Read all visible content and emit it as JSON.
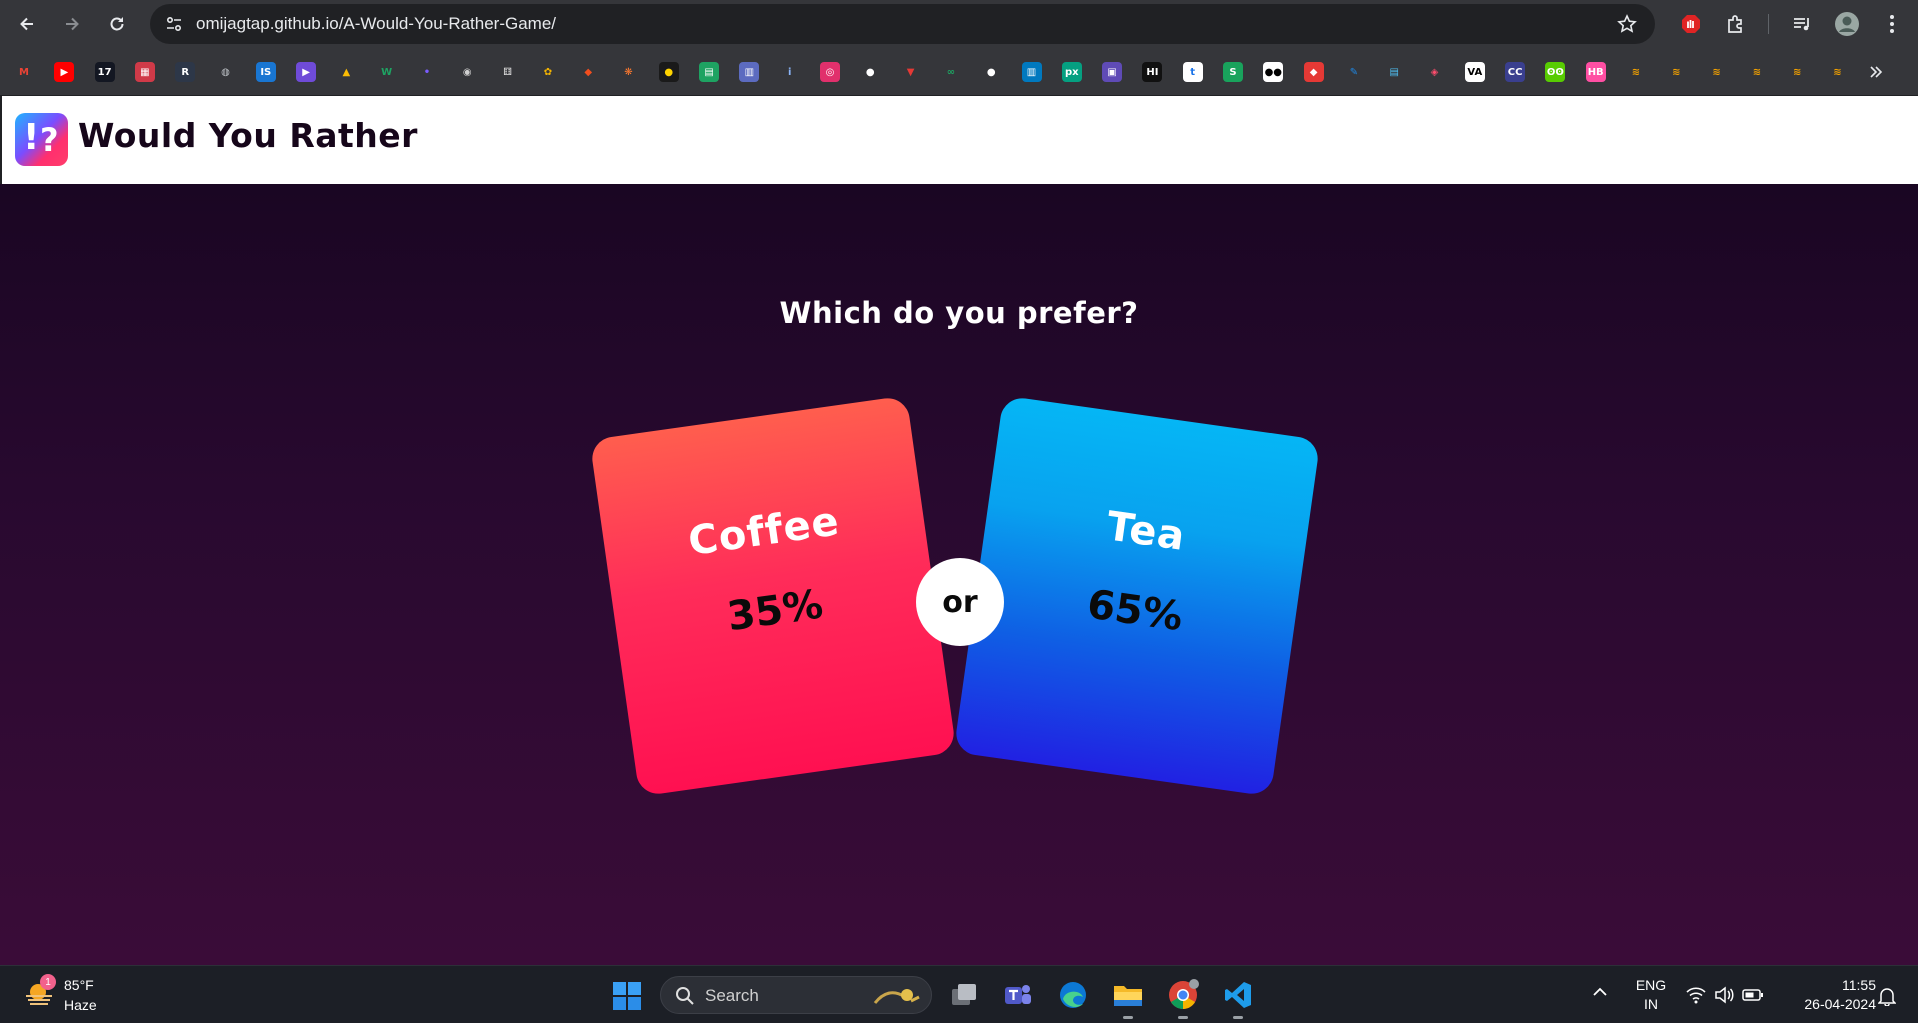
{
  "browser": {
    "url": "omijagtap.github.io/A-Would-You-Rather-Game/",
    "bookmarks": [
      {
        "icon": "gmail-icon",
        "text": "M",
        "color": "#ea4335",
        "bg": "transparent"
      },
      {
        "icon": "youtube-icon",
        "text": "▶",
        "color": "#ffffff",
        "bg": "#ff0000"
      },
      {
        "icon": "tradingview-icon",
        "text": "17",
        "color": "#ffffff",
        "bg": "#131722"
      },
      {
        "icon": "bookmark-red-icon",
        "text": "▦",
        "color": "#ffffff",
        "bg": "#d03a48"
      },
      {
        "icon": "bookmark-r-icon",
        "text": "R",
        "color": "#ffffff",
        "bg": "#2d3748"
      },
      {
        "icon": "globe-icon",
        "text": "◍",
        "color": "#bdc1c6",
        "bg": "transparent"
      },
      {
        "icon": "bookmark-is-icon",
        "text": "IS",
        "color": "#ffffff",
        "bg": "#1976d2"
      },
      {
        "icon": "bookmark-play-icon",
        "text": "▶",
        "color": "#ffffff",
        "bg": "#6f4bd8"
      },
      {
        "icon": "google-drive-icon",
        "text": "▲",
        "color": "#fbbc04",
        "bg": "transparent"
      },
      {
        "icon": "bookmark-w-icon",
        "text": "W",
        "color": "#1ea362",
        "bg": "transparent"
      },
      {
        "icon": "bookmark-dots-icon",
        "text": "•",
        "color": "#7b5cff",
        "bg": "transparent"
      },
      {
        "icon": "bookmark-eye-icon",
        "text": "◉",
        "color": "#d0d0d0",
        "bg": "transparent"
      },
      {
        "icon": "dice-icon",
        "text": "⚅",
        "color": "#e0e0e0",
        "bg": "transparent"
      },
      {
        "icon": "google-photos-icon",
        "text": "✿",
        "color": "#f4b400",
        "bg": "transparent"
      },
      {
        "icon": "figma-icon",
        "text": "◆",
        "color": "#f24e1e",
        "bg": "transparent"
      },
      {
        "icon": "bookmark-orange-icon",
        "text": "❋",
        "color": "#ff7a2f",
        "bg": "transparent"
      },
      {
        "icon": "bookmark-yellow-icon",
        "text": "●",
        "color": "#ffd400",
        "bg": "#1a1a1a"
      },
      {
        "icon": "google-sheets-icon",
        "text": "▤",
        "color": "#ffffff",
        "bg": "#1ea362"
      },
      {
        "icon": "google-forms-icon",
        "text": "▥",
        "color": "#ffffff",
        "bg": "#5c6bc0"
      },
      {
        "icon": "bookmark-i-icon",
        "text": "i",
        "color": "#8ab4f8",
        "bg": "transparent"
      },
      {
        "icon": "instagram-icon",
        "text": "◎",
        "color": "#ffffff",
        "bg": "#e1306c"
      },
      {
        "icon": "github-icon",
        "text": "●",
        "color": "#ffffff",
        "bg": "transparent"
      },
      {
        "icon": "bookmark-triangle-icon",
        "text": "▼",
        "color": "#e53935",
        "bg": "transparent"
      },
      {
        "icon": "bookmark-infinity-icon",
        "text": "∞",
        "color": "#1ea362",
        "bg": "transparent"
      },
      {
        "icon": "github-icon",
        "text": "●",
        "color": "#ffffff",
        "bg": "transparent"
      },
      {
        "icon": "trello-icon",
        "text": "▥",
        "color": "#ffffff",
        "bg": "#0079bf"
      },
      {
        "icon": "bookmark-px-icon",
        "text": "px",
        "color": "#ffffff",
        "bg": "#05a081"
      },
      {
        "icon": "bookmark-camera-icon",
        "text": "▣",
        "color": "#ffffff",
        "bg": "#5f4bb6"
      },
      {
        "icon": "bookmark-hi-icon",
        "text": "HI",
        "color": "#ffffff",
        "bg": "#111111"
      },
      {
        "icon": "bookmark-t-icon",
        "text": "t",
        "color": "#1a73e8",
        "bg": "#ffffff"
      },
      {
        "icon": "bookmark-swirl-icon",
        "text": "S",
        "color": "#ffffff",
        "bg": "#19a35c"
      },
      {
        "icon": "medium-icon",
        "text": "●●",
        "color": "#000000",
        "bg": "#ffffff"
      },
      {
        "icon": "bookmark-shield-icon",
        "text": "◆",
        "color": "#ffffff",
        "bg": "#e53935"
      },
      {
        "icon": "bookmark-pen-icon",
        "text": "✎",
        "color": "#1e88e5",
        "bg": "transparent"
      },
      {
        "icon": "bookmark-book-icon",
        "text": "▤",
        "color": "#4fc3f7",
        "bg": "transparent"
      },
      {
        "icon": "bookmark-tag-icon",
        "text": "◈",
        "color": "#ff4d6d",
        "bg": "transparent"
      },
      {
        "icon": "bookmark-va-icon",
        "text": "VA",
        "color": "#000000",
        "bg": "#ffffff"
      },
      {
        "icon": "bookmark-cc-icon",
        "text": "CC",
        "color": "#ffffff",
        "bg": "#3a3f8f"
      },
      {
        "icon": "duolingo-icon",
        "text": "ʘʘ",
        "color": "#ffffff",
        "bg": "#58cc02"
      },
      {
        "icon": "bookmark-pink-icon",
        "text": "HB",
        "color": "#ffffff",
        "bg": "#ff4fa3"
      },
      {
        "icon": "bookmark-folder-icon",
        "text": "≋",
        "color": "#f2a100",
        "bg": "transparent"
      },
      {
        "icon": "bookmark-folder-icon",
        "text": "≋",
        "color": "#f2a100",
        "bg": "transparent"
      },
      {
        "icon": "bookmark-folder-icon",
        "text": "≋",
        "color": "#f2a100",
        "bg": "transparent"
      },
      {
        "icon": "bookmark-folder-icon",
        "text": "≋",
        "color": "#f2a100",
        "bg": "transparent"
      },
      {
        "icon": "bookmark-folder-icon",
        "text": "≋",
        "color": "#f2a100",
        "bg": "transparent"
      },
      {
        "icon": "bookmark-folder-icon",
        "text": "≋",
        "color": "#f2a100",
        "bg": "transparent"
      }
    ]
  },
  "site": {
    "title": "Would You Rather",
    "logo_glyph_1": "!",
    "logo_glyph_2": "?"
  },
  "game": {
    "question": "Which do you prefer?",
    "option_a": {
      "label": "Coffee",
      "percent": "35%"
    },
    "option_b": {
      "label": "Tea",
      "percent": "65%"
    },
    "separator": "or"
  },
  "taskbar": {
    "weather_badge": "1",
    "weather_temp": "85°F",
    "weather_condition": "Haze",
    "search_placeholder": "Search",
    "lang_line1": "ENG",
    "lang_line2": "IN",
    "time": "11:55",
    "date": "26-04-2024"
  }
}
